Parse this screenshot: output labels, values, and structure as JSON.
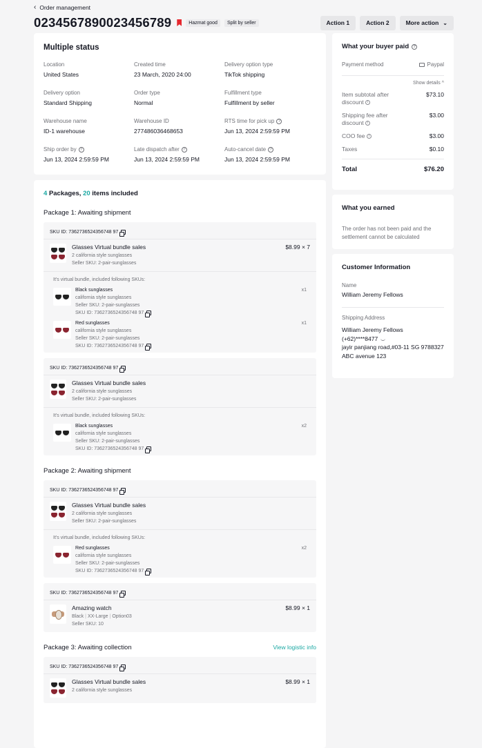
{
  "breadcrumb": {
    "label": "Order management"
  },
  "order": {
    "id": "0234567890023456789",
    "tags": [
      "Hazmat good",
      "Split by seller"
    ]
  },
  "actions": {
    "action1": "Action 1",
    "action2": "Action 2",
    "more": "More action"
  },
  "status": {
    "title": "Multiple status",
    "fields": [
      {
        "label": "Location",
        "value": "United States",
        "help": false
      },
      {
        "label": "Created time",
        "value": "23 March, 2020 24:00",
        "help": false
      },
      {
        "label": "Delivery option type",
        "value": "TikTok shipping",
        "help": false
      },
      {
        "label": "Delivery option",
        "value": "Standard Shipping",
        "help": false
      },
      {
        "label": "Order type",
        "value": "Normal",
        "help": false
      },
      {
        "label": "Fulfillment type",
        "value": "Fulfillment by seller",
        "help": false
      },
      {
        "label": "Warehouse name",
        "value": "ID-1 warehouse",
        "help": false
      },
      {
        "label": "Warehouse ID",
        "value": "277486036468653",
        "help": false
      },
      {
        "label": "RTS time for pick up",
        "value": "Jun 13, 2024 2:59:59 PM",
        "help": true
      },
      {
        "label": "Ship order by",
        "value": "Jun 13, 2024 2:59:59 PM",
        "help": true
      },
      {
        "label": "Late dispatch after",
        "value": "Jun 13, 2024 2:59:59 PM",
        "help": true
      },
      {
        "label": "Auto-cancel date",
        "value": "Jun 13, 2024 2:59:59 PM",
        "help": true
      }
    ]
  },
  "packages_summary": {
    "packages": "4",
    "packages_label": "Packages,",
    "items": "20",
    "items_label": "items included"
  },
  "packages": [
    {
      "title": "Package 1: Awaiting shipment",
      "link": "",
      "skus": [
        {
          "sku_id": "SKU ID: 7362736524356748 97",
          "name": "Glasses Virtual bundle sales",
          "sub1": "2 california style sunglasses",
          "sub2": "Seller SKU: 2-pair-sunglasses",
          "price": "$8.99 × 7",
          "thumb": "glasses",
          "bundle_note": "It's virtual bundle, included following SKUs:",
          "bundle": [
            {
              "name": "Black sunglasses",
              "style": "california style sunglasses",
              "seller_sku": "Seller SKU: 2-pair-sunglasses",
              "sku_id": "SKU ID: 7362736524356748 97",
              "qty": "x1",
              "color": "black"
            },
            {
              "name": "Red sunglasses",
              "style": "california style sunglasses",
              "seller_sku": "Seller SKU: 2-pair-sunglasses",
              "sku_id": "SKU ID: 7362736524356748 97",
              "qty": "x1",
              "color": "red"
            }
          ]
        },
        {
          "sku_id": "SKU ID: 7362736524356748 97",
          "name": "Glasses Virtual bundle sales",
          "sub1": "2 california style sunglasses",
          "sub2": "Seller SKU: 2-pair-sunglasses",
          "price": "",
          "thumb": "glasses",
          "bundle_note": "It's virtual bundle, included following SKUs:",
          "bundle": [
            {
              "name": "Black sunglasses",
              "style": "california style sunglasses",
              "seller_sku": "Seller SKU: 2-pair-sunglasses",
              "sku_id": "SKU ID: 7362736524356748 97",
              "qty": "x2",
              "color": "black"
            }
          ]
        }
      ]
    },
    {
      "title": "Package 2: Awaiting shipment",
      "link": "",
      "skus": [
        {
          "sku_id": "SKU ID: 7362736524356748 97",
          "name": "Glasses Virtual bundle sales",
          "sub1": "2 california style sunglasses",
          "sub2": "Seller SKU: 2-pair-sunglasses",
          "price": "",
          "thumb": "glasses",
          "bundle_note": "It's virtual bundle, included following SKUs:",
          "bundle": [
            {
              "name": "Red sunglasses",
              "style": "california style sunglasses",
              "seller_sku": "Seller SKU: 2-pair-sunglasses",
              "sku_id": "SKU ID: 7362736524356748 97",
              "qty": "x2",
              "color": "red"
            }
          ]
        },
        {
          "sku_id": "SKU ID: 7362736524356748 97",
          "name": "Amazing watch",
          "sub1": [
            "Black",
            "XX-Large",
            "Option03"
          ],
          "sub2": "Seller SKU: 10",
          "price": "$8.99 × 1",
          "thumb": "watch",
          "bundle_note": "",
          "bundle": []
        }
      ]
    },
    {
      "title": "Package 3: Awaiting collection",
      "link": "View logistic info",
      "skus": [
        {
          "sku_id": "SKU ID: 7362736524356748 97",
          "name": "Glasses Virtual bundle sales",
          "sub1": "2 california style sunglasses",
          "sub2": "",
          "price": "$8.99 × 1",
          "thumb": "glasses",
          "bundle_note": "",
          "bundle": []
        }
      ]
    }
  ],
  "payment": {
    "title": "What your buyer paid",
    "method_label": "Payment method",
    "method_value": "Paypal",
    "show_details": "Show details",
    "lines": [
      {
        "label": "Item subtotal after discount",
        "value": "$73.10",
        "info": true
      },
      {
        "label": "Shipping fee after discount",
        "value": "$3.00",
        "info": true
      },
      {
        "label": "COO fee",
        "value": "$3.00",
        "info": true
      },
      {
        "label": "Taxes",
        "value": "$0.10",
        "info": false
      }
    ],
    "total_label": "Total",
    "total_value": "$76.20"
  },
  "earned": {
    "title": "What you earned",
    "text": "The order has not been paid and the settlement cannot be calculated"
  },
  "customer": {
    "title": "Customer Information",
    "name_label": "Name",
    "name": "William Jeremy Fellows",
    "address_label": "Shipping Address",
    "address_name": "William Jeremy Fellows",
    "phone": "(+62)****8477",
    "address_line1": "jayir panjiang road,#03-11 SG 9788327",
    "address_line2": "ABC avenue 123"
  },
  "colors": {
    "accent": "#1ba8a3",
    "flag": "#e6282f",
    "background": "#f5f5f6"
  },
  "icons": [
    "chevron-left-icon",
    "bookmark-flag-icon",
    "chevron-down-icon",
    "help-icon",
    "copy-icon",
    "card-icon",
    "info-icon",
    "eye-icon"
  ]
}
